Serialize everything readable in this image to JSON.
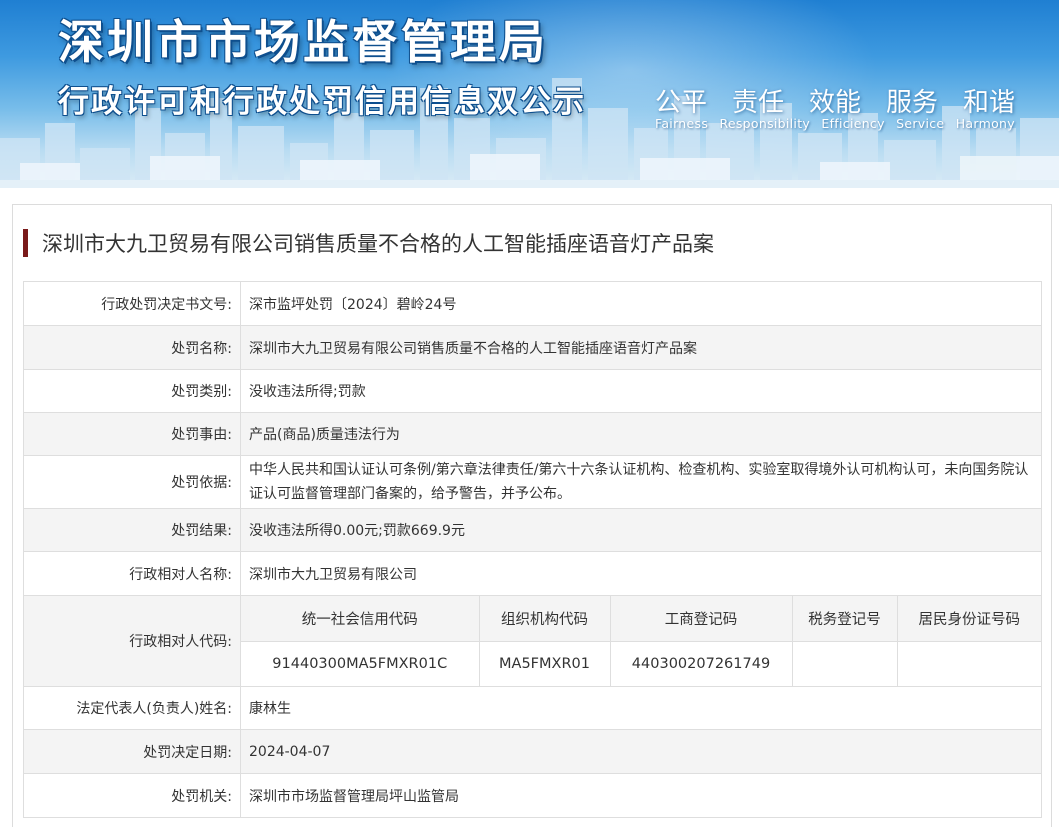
{
  "banner": {
    "title_main": "深圳市市场监督管理局",
    "title_sub": "行政许可和行政处罚信用信息双公示",
    "values_cn": [
      "公平",
      "责任",
      "效能",
      "服务",
      "和谐"
    ],
    "values_en": [
      "Fairness",
      "Responsibility",
      "Efficiency",
      "Service",
      "Harmony"
    ]
  },
  "case_title": "深圳市大九卫贸易有限公司销售质量不合格的人工智能插座语音灯产品案",
  "fields": {
    "decision_no": {
      "label": "行政处罚决定书文号:",
      "value": "深市监坪处罚〔2024〕碧岭24号"
    },
    "penalty_name": {
      "label": "处罚名称:",
      "value": "深圳市大九卫贸易有限公司销售质量不合格的人工智能插座语音灯产品案"
    },
    "penalty_type": {
      "label": "处罚类别:",
      "value": "没收违法所得;罚款"
    },
    "penalty_reason": {
      "label": "处罚事由:",
      "value": "产品(商品)质量违法行为"
    },
    "penalty_basis": {
      "label": "处罚依据:",
      "value": "中华人民共和国认证认可条例/第六章法律责任/第六十六条认证机构、检查机构、实验室取得境外认可机构认可，未向国务院认证认可监督管理部门备案的，给予警告，并予公布。"
    },
    "penalty_result": {
      "label": "处罚结果:",
      "value": "没收违法所得0.00元;罚款669.9元"
    },
    "counterpart_name": {
      "label": "行政相对人名称:",
      "value": "深圳市大九卫贸易有限公司"
    },
    "counterpart_code": {
      "label": "行政相对人代码:",
      "headers": [
        "统一社会信用代码",
        "组织机构代码",
        "工商登记码",
        "税务登记号",
        "居民身份证号码"
      ],
      "values": [
        "91440300MA5FMXR01C",
        "MA5FMXR01",
        "440300207261749",
        "",
        ""
      ]
    },
    "legal_rep": {
      "label": "法定代表人(负责人)姓名:",
      "value": "康林生"
    },
    "decision_date": {
      "label": "处罚决定日期:",
      "value": "2024-04-07"
    },
    "authority": {
      "label": "处罚机关:",
      "value": "深圳市市场监督管理局坪山监管局"
    }
  },
  "colors": {
    "banner_top": "#1f7fd2",
    "heading_bar": "#7a1a1a",
    "alt_row": "#f4f4f4",
    "border": "#dedede"
  }
}
